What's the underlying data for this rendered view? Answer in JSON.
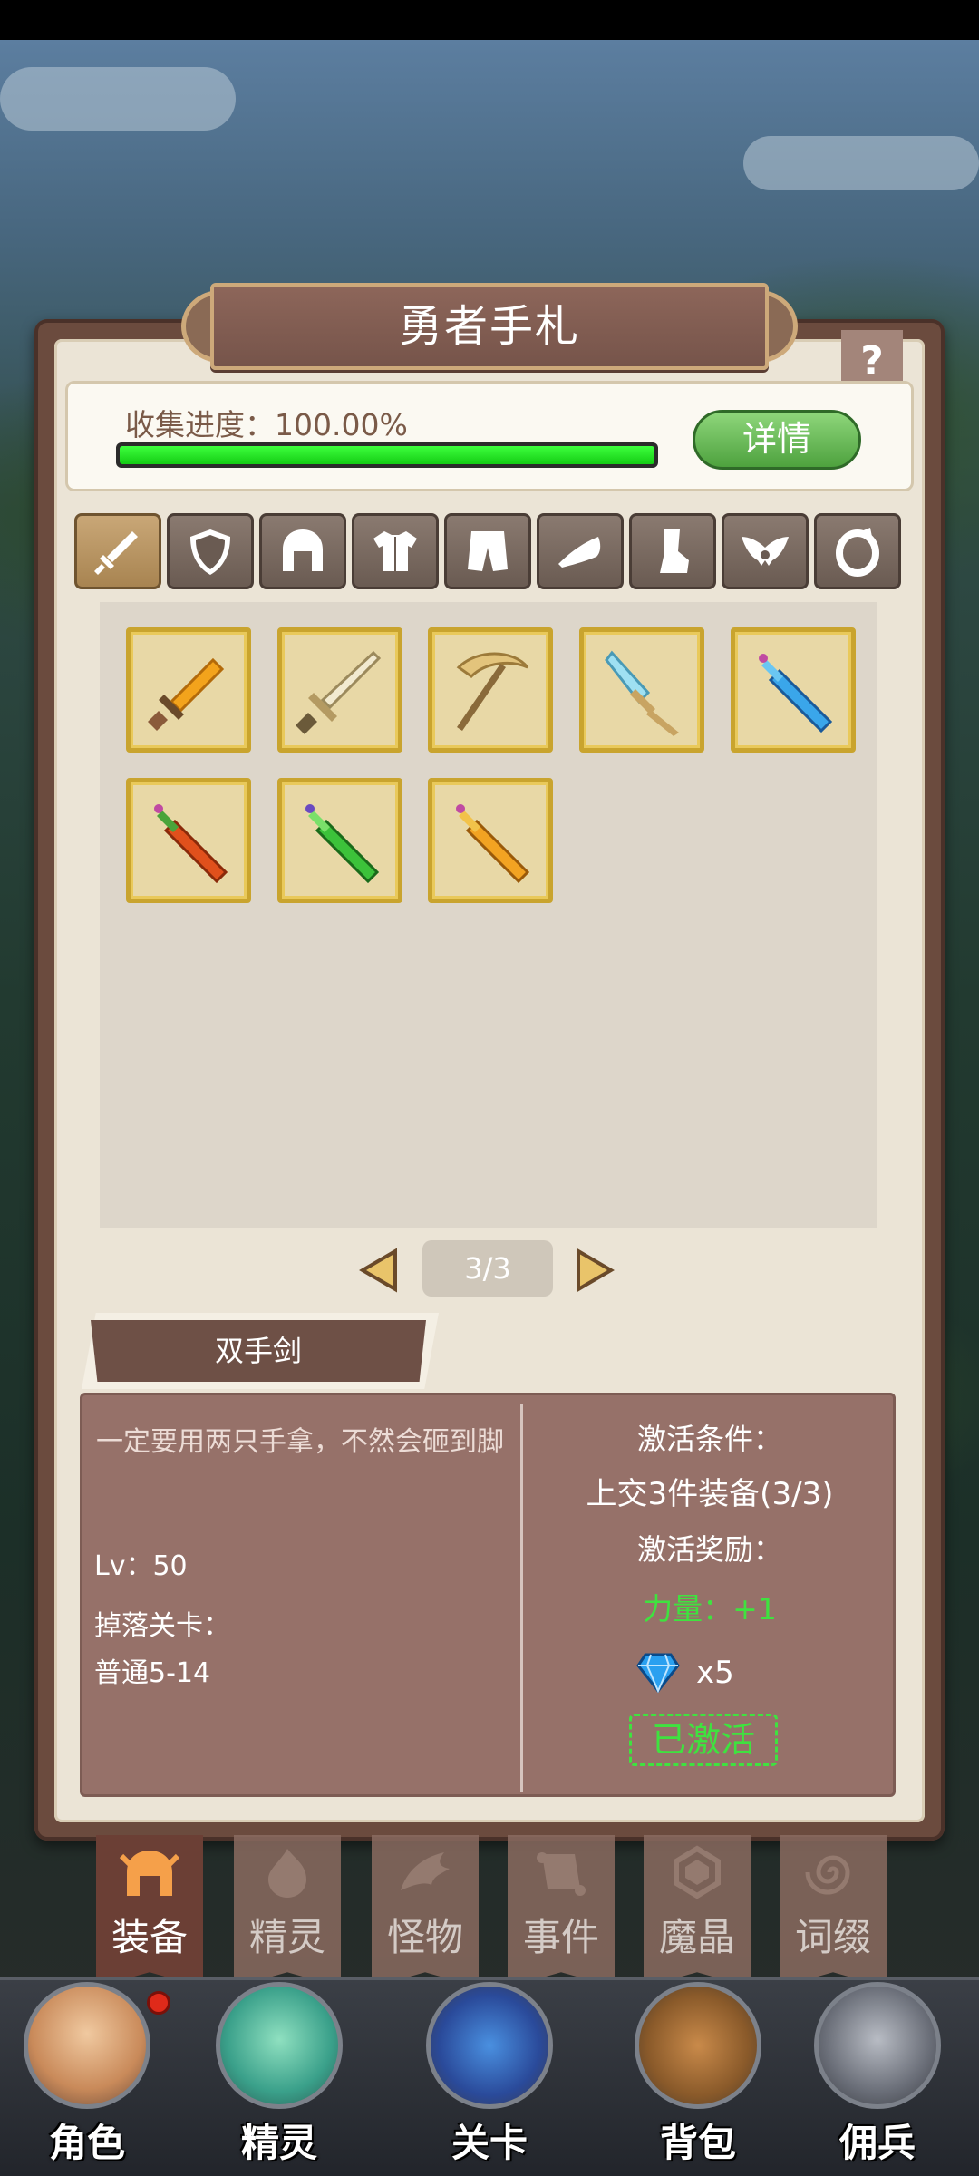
{
  "title": "勇者手札",
  "help_label": "?",
  "progress": {
    "label": "收集进度：100.00%",
    "percent": 100,
    "detail_button": "详情"
  },
  "category_tabs": [
    {
      "name": "sword",
      "icon": "sword-icon",
      "active": true
    },
    {
      "name": "shield",
      "icon": "shield-icon",
      "active": false
    },
    {
      "name": "helmet",
      "icon": "helmet-icon",
      "active": false
    },
    {
      "name": "armor",
      "icon": "armor-icon",
      "active": false
    },
    {
      "name": "pants",
      "icon": "pants-icon",
      "active": false
    },
    {
      "name": "shoes",
      "icon": "shoes-icon",
      "active": false
    },
    {
      "name": "boots",
      "icon": "boots-icon",
      "active": false
    },
    {
      "name": "wings",
      "icon": "wings-icon",
      "active": false
    },
    {
      "name": "ring",
      "icon": "ring-icon",
      "active": false
    }
  ],
  "items": [
    {
      "icon": "golden-sword-icon",
      "color": "#f3a31c"
    },
    {
      "icon": "silver-greatsword-icon",
      "color": "#e7d9b0"
    },
    {
      "icon": "scythe-icon",
      "color": "#d8b46a"
    },
    {
      "icon": "ice-dagger-icon",
      "color": "#8fd0e8"
    },
    {
      "icon": "blue-crystal-sword-icon",
      "color": "#3aa6ea"
    },
    {
      "icon": "red-crystal-sword-icon",
      "color": "#e0501c"
    },
    {
      "icon": "green-crystal-sword-icon",
      "color": "#3cc23a"
    },
    {
      "icon": "orange-crystal-sword-icon",
      "color": "#f2a322"
    }
  ],
  "pager": {
    "text": "3/3"
  },
  "selected_item": {
    "name": "双手剑",
    "description": "一定要用两只手拿，不然会砸到脚",
    "level": "Lv：50",
    "drop_label": "掉落关卡：",
    "drop_stage": "普通5-14",
    "condition_label": "激活条件：",
    "condition_text": "上交3件装备(3/3)",
    "reward_label": "激活奖励：",
    "reward_stat": "力量：+1",
    "gem_count": "x5",
    "status": "已激活"
  },
  "sub_tabs": [
    {
      "label": "装备",
      "icon": "helmet-icon",
      "active": true
    },
    {
      "label": "精灵",
      "icon": "flame-icon",
      "active": false
    },
    {
      "label": "怪物",
      "icon": "dragon-icon",
      "active": false
    },
    {
      "label": "事件",
      "icon": "scroll-icon",
      "active": false
    },
    {
      "label": "魔晶",
      "icon": "crystal-icon",
      "active": false
    },
    {
      "label": "词缀",
      "icon": "swirl-icon",
      "active": false
    }
  ],
  "bottom_nav": [
    {
      "label": "角色",
      "icon": "character-avatar-icon",
      "badge": true
    },
    {
      "label": "精灵",
      "icon": "slime-icon",
      "badge": false
    },
    {
      "label": "关卡",
      "icon": "stage-swords-icon",
      "badge": false
    },
    {
      "label": "背包",
      "icon": "backpack-icon",
      "badge": false
    },
    {
      "label": "佣兵",
      "icon": "knight-helmet-icon",
      "badge": false
    }
  ],
  "colors": {
    "accent_green": "#3fe23f",
    "panel_brown": "#6b4b3e",
    "gold_frame": "#c9a42e"
  }
}
